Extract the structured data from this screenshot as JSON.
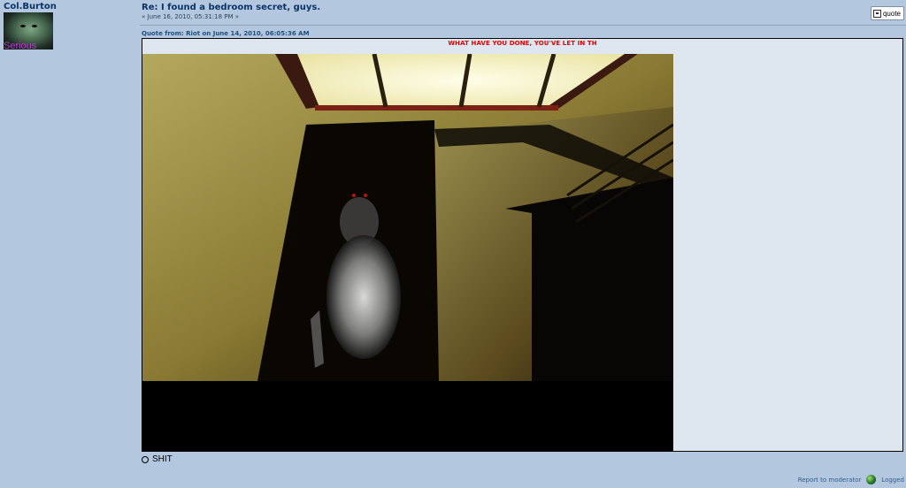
{
  "poster": {
    "name": "Col.Burton",
    "avatar_caption": "Serious"
  },
  "post": {
    "subject": "Re: I found a bedroom secret, guys.",
    "date": "« June 16, 2010, 05:31:18 PM »",
    "quote_button_label": "quote"
  },
  "quote": {
    "header": "Quote from: Riot on June 14, 2010, 06:05:36 AM",
    "text": "WHAT HAVE YOU DONE, YOU'VE LET IN TH",
    "image_alt": "dark room ceiling with ghostly figure"
  },
  "caption": {
    "text": "SHIT"
  },
  "footer": {
    "report_label": "Report to moderator",
    "logged_label": "Logged"
  },
  "colors": {
    "background": "#b3c8de",
    "quote_text": "#e60000",
    "link": "#0b3366"
  },
  "icons": [
    "quote-icon",
    "circle-icon",
    "globe-icon"
  ]
}
